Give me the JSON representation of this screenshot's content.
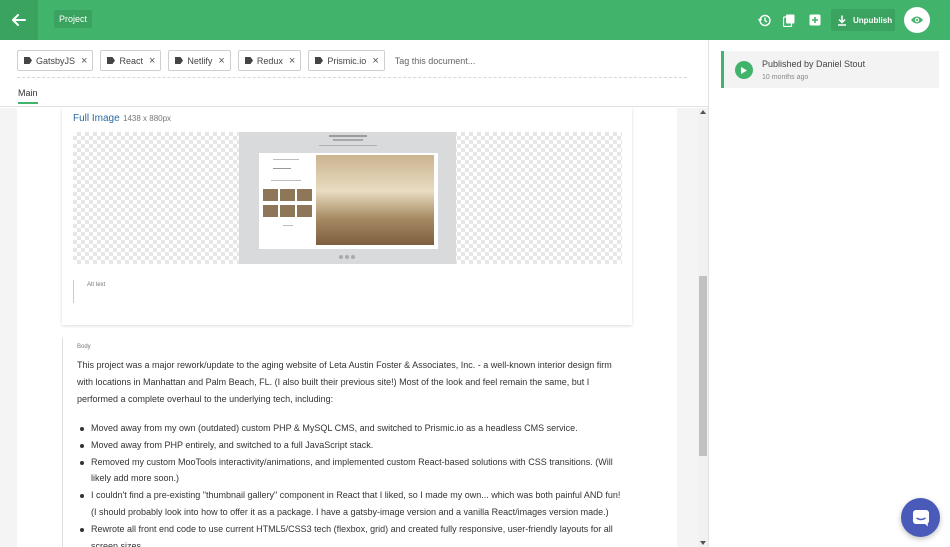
{
  "topbar": {
    "project_label": "Project",
    "unpublish_label": "Unpublish",
    "accent_color": "#42b36b",
    "icons": [
      "arrow-left-icon",
      "history-icon",
      "duplicate-icon",
      "add-icon",
      "download-icon",
      "eye-icon"
    ]
  },
  "tags": {
    "items": [
      {
        "label": "GatsbyJS"
      },
      {
        "label": "React"
      },
      {
        "label": "Netlify"
      },
      {
        "label": "Redux"
      },
      {
        "label": "Prismic.io"
      }
    ],
    "input_placeholder": "Tag this document..."
  },
  "tabs": {
    "main_label": "Main"
  },
  "image_field": {
    "title": "Full Image",
    "dimensions": "1438 x 880px",
    "alt_placeholder": "Alt text"
  },
  "body": {
    "label": "Body",
    "paragraph": "This project was a major rework/update to the aging website of Leta Austin Foster & Associates, Inc. - a well-known interior design firm with locations in Manhattan and Palm Beach, FL. (I also built their previous site!) Most of the look and feel remain the same, but I performed a complete overhaul to the underlying tech, including:",
    "bullets": [
      "Moved away from my own (outdated) custom PHP & MySQL CMS, and switched to Prismic.io as a headless CMS service.",
      "Moved away from PHP entirely, and switched to a full JavaScript stack.",
      "Removed my custom MooTools interactivity/animations, and implemented custom React-based solutions with CSS transitions. (Will likely add more soon.)",
      "I couldn't find a pre-existing \"thumbnail gallery\" component in React that I liked, so I made my own... which was both painful AND fun! (I should probably look into how to offer it as a package.  I have a gatsby-image version and a vanilla React/images version made.)",
      "Rewrote all front end code to use current HTML5/CSS3 tech (flexbox, grid) and created fully responsive, user-friendly layouts for all screen sizes."
    ]
  },
  "status": {
    "title": "Published by Daniel Stout",
    "time": "10 months ago"
  }
}
